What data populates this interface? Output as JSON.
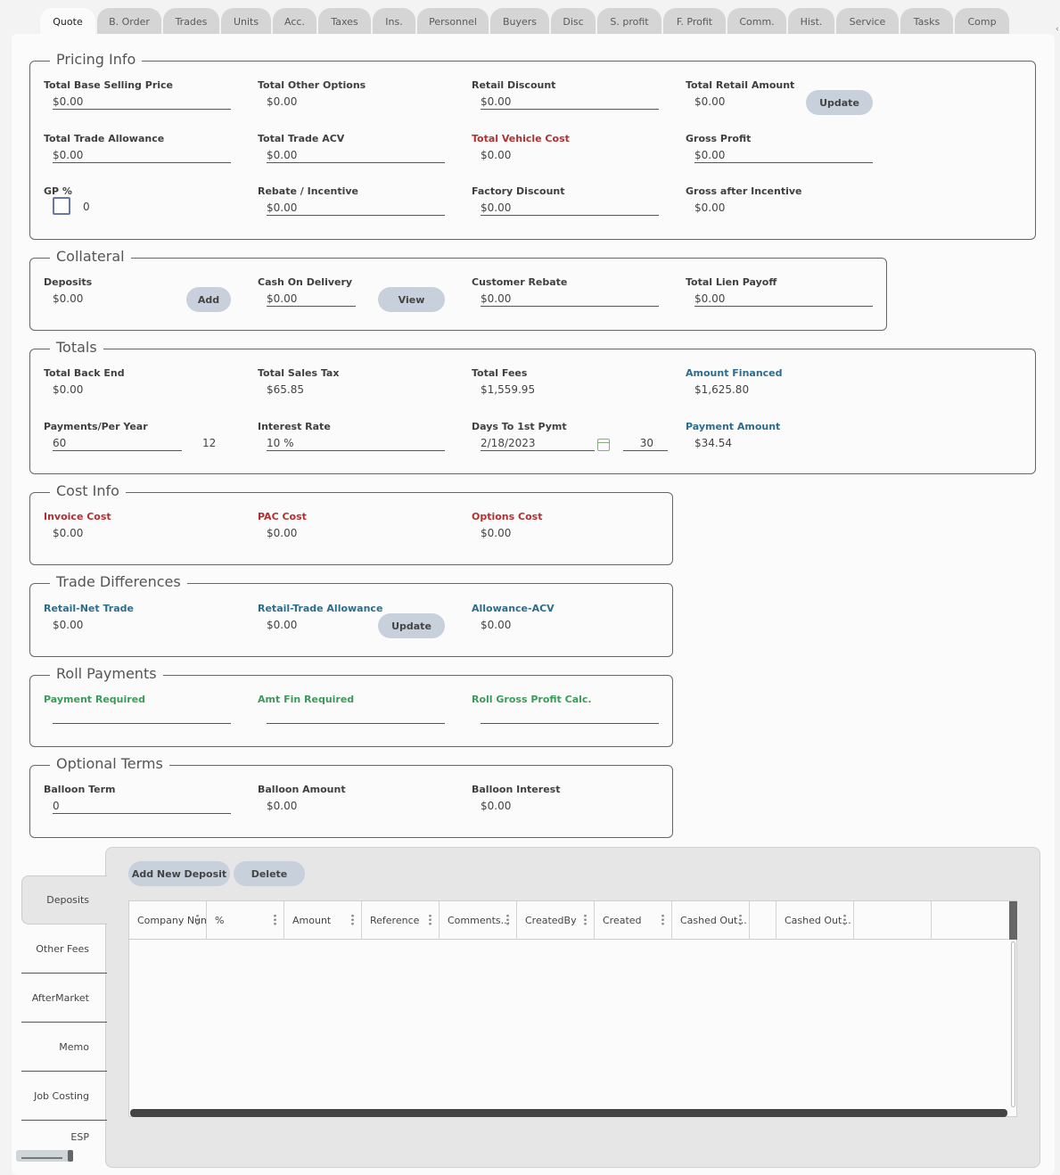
{
  "tabs": [
    "Quote",
    "B. Order",
    "Trades",
    "Units",
    "Acc.",
    "Taxes",
    "Ins.",
    "Personnel",
    "Buyers",
    "Disc",
    "S. profit",
    "F. Profit",
    "Comm.",
    "Hist.",
    "Service",
    "Tasks",
    "Comp"
  ],
  "active_tab": "Quote",
  "pricing": {
    "title": "Pricing Info",
    "total_base_selling_price": {
      "label": "Total Base Selling Price",
      "value": "$0.00"
    },
    "total_other_options": {
      "label": "Total Other Options",
      "value": "$0.00"
    },
    "retail_discount": {
      "label": "Retail Discount",
      "value": "$0.00"
    },
    "total_retail_amount": {
      "label": "Total Retail Amount",
      "value": "$0.00"
    },
    "update_label": "Update",
    "total_trade_allowance": {
      "label": "Total Trade Allowance",
      "value": "$0.00"
    },
    "total_trade_acv": {
      "label": "Total Trade ACV",
      "value": "$0.00"
    },
    "total_vehicle_cost": {
      "label": "Total Vehicle Cost",
      "value": "$0.00"
    },
    "gross_profit": {
      "label": "Gross Profit",
      "value": "$0.00"
    },
    "gp_percent": {
      "label": "GP %",
      "value": "0"
    },
    "rebate_incentive": {
      "label": "Rebate / Incentive",
      "value": "$0.00"
    },
    "factory_discount": {
      "label": "Factory Discount",
      "value": "$0.00"
    },
    "gross_after_incentive": {
      "label": "Gross after Incentive",
      "value": "$0.00"
    }
  },
  "collateral": {
    "title": "Collateral",
    "deposits": {
      "label": "Deposits",
      "value": "$0.00"
    },
    "add_label": "Add",
    "cash_on_delivery": {
      "label": "Cash On Delivery",
      "value": "$0.00"
    },
    "view_label": "View",
    "customer_rebate": {
      "label": "Customer Rebate",
      "value": "$0.00"
    },
    "total_lien_payoff": {
      "label": "Total Lien Payoff",
      "value": "$0.00"
    }
  },
  "totals": {
    "title": "Totals",
    "total_back_end": {
      "label": "Total Back End",
      "value": "$0.00"
    },
    "total_sales_tax": {
      "label": "Total Sales Tax",
      "value": "$65.85"
    },
    "total_fees": {
      "label": "Total Fees",
      "value": "$1,559.95"
    },
    "amount_financed": {
      "label": "Amount Financed",
      "value": "$1,625.80"
    },
    "payments_per_year": {
      "label": "Payments/Per Year",
      "value": "60",
      "per_year": "12"
    },
    "interest_rate": {
      "label": "Interest Rate",
      "value": "10 %"
    },
    "days_to_first_pymt": {
      "label": "Days To 1st Pymt",
      "date": "2/18/2023",
      "days": "30"
    },
    "payment_amount": {
      "label": "Payment Amount",
      "value": "$34.54"
    }
  },
  "cost_info": {
    "title": "Cost Info",
    "invoice_cost": {
      "label": "Invoice Cost",
      "value": "$0.00"
    },
    "pac_cost": {
      "label": "PAC Cost",
      "value": "$0.00"
    },
    "options_cost": {
      "label": "Options Cost",
      "value": "$0.00"
    }
  },
  "trade_diff": {
    "title": "Trade Differences",
    "retail_net_trade": {
      "label": "Retail-Net Trade",
      "value": "$0.00"
    },
    "retail_trade_allowance": {
      "label": "Retail-Trade Allowance",
      "value": "$0.00"
    },
    "update_label": "Update",
    "allowance_acv": {
      "label": "Allowance-ACV",
      "value": "$0.00"
    }
  },
  "roll_payments": {
    "title": "Roll Payments",
    "payment_required": {
      "label": "Payment Required",
      "value": ""
    },
    "amt_fin_required": {
      "label": "Amt Fin Required",
      "value": ""
    },
    "roll_gross_profit": {
      "label": "Roll Gross Profit Calc.",
      "value": ""
    }
  },
  "optional_terms": {
    "title": "Optional Terms",
    "balloon_term": {
      "label": "Balloon Term",
      "value": "0"
    },
    "balloon_amount": {
      "label": "Balloon Amount",
      "value": "$0.00"
    },
    "balloon_interest": {
      "label": "Balloon Interest",
      "value": "$0.00"
    }
  },
  "side_tabs": [
    "Deposits",
    "Other Fees",
    "AfterMarket",
    "Memo",
    "Job Costing",
    "ESP"
  ],
  "deposits_panel": {
    "add_new_deposit_label": "Add New Deposit",
    "delete_label": "Delete",
    "columns": [
      "Company Num.",
      "%",
      "Amount",
      "Reference",
      "Comments...",
      "CreatedBy",
      "Created",
      "Cashed Out...",
      "",
      "Cashed Out...",
      ""
    ]
  }
}
